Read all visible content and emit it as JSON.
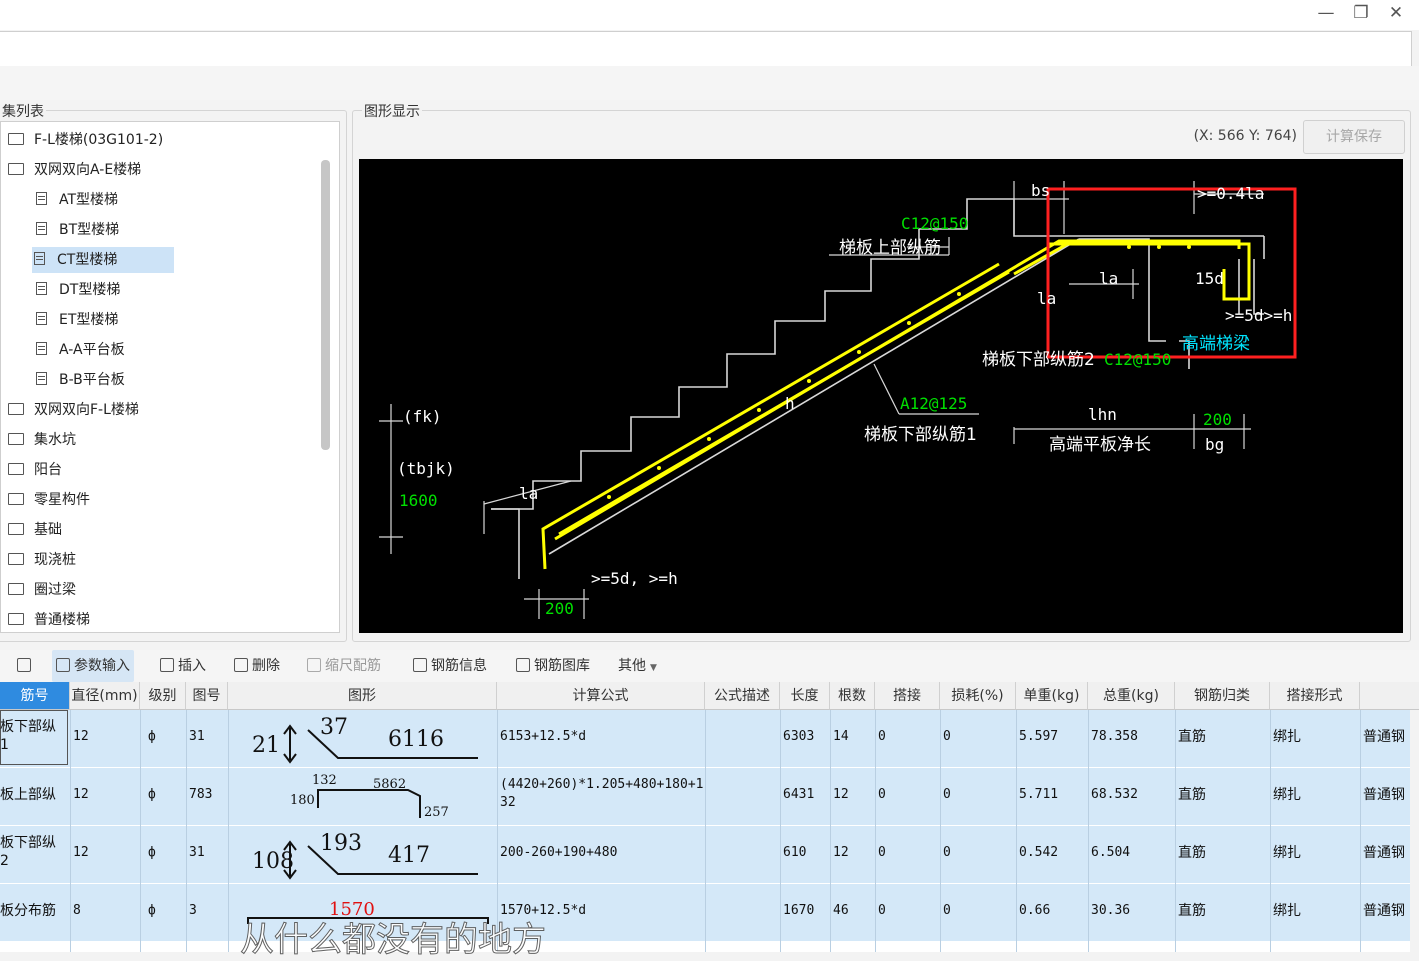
{
  "window": {
    "min": "—",
    "restore": "❐",
    "close": "✕"
  },
  "left_panel": {
    "title": "集列表",
    "items": [
      {
        "label": "F-L楼梯(03G101-2)",
        "type": "folder",
        "level": 0,
        "expanded": false
      },
      {
        "label": "双网双向A-E楼梯",
        "type": "folder",
        "level": 0,
        "expanded": true
      },
      {
        "label": "AT型楼梯",
        "type": "doc",
        "level": 1
      },
      {
        "label": "BT型楼梯",
        "type": "doc",
        "level": 1
      },
      {
        "label": "CT型楼梯",
        "type": "doc",
        "level": 1,
        "selected": true
      },
      {
        "label": "DT型楼梯",
        "type": "doc",
        "level": 1
      },
      {
        "label": "ET型楼梯",
        "type": "doc",
        "level": 1
      },
      {
        "label": "A-A平台板",
        "type": "doc",
        "level": 1
      },
      {
        "label": "B-B平台板",
        "type": "doc",
        "level": 1
      },
      {
        "label": "双网双向F-L楼梯",
        "type": "folder",
        "level": 0
      },
      {
        "label": "集水坑",
        "type": "folder",
        "level": 0
      },
      {
        "label": "阳台",
        "type": "folder",
        "level": 0
      },
      {
        "label": "零星构件",
        "type": "folder",
        "level": 0
      },
      {
        "label": "基础",
        "type": "folder",
        "level": 0
      },
      {
        "label": "现浇桩",
        "type": "folder",
        "level": 0
      },
      {
        "label": "圈过梁",
        "type": "folder",
        "level": 0
      },
      {
        "label": "普通楼梯",
        "type": "folder",
        "level": 0
      }
    ]
  },
  "graphic_panel": {
    "title": "图形显示",
    "coords": "(X: 566 Y: 764)",
    "save_button": "计算保存",
    "drawing": {
      "bs": "bs",
      "la_top": ">=0.4la",
      "c12_150": "C12@150",
      "upper_bar": "梯板上部纵筋",
      "la1": "la",
      "la2": "la",
      "d15": "15d",
      "d5h": ">=5d>=h",
      "high_beam": "高端梯梁",
      "lower_bar2": "梯板下部纵筋2",
      "lower_bar2_spec": "C12@150",
      "h": "h",
      "a12_125": "A12@125",
      "lower_bar1": "梯板下部纵筋1",
      "lhn": "lhn",
      "high_slab": "高端平板净长",
      "v200_right": "200",
      "bg": "bg",
      "fk": "(fk)",
      "tbjk": "(tbjk)",
      "v1600": "1600",
      "la_low": "la",
      "d5_low": ">=5d, >=h",
      "v200_low": "200"
    }
  },
  "toolbar": {
    "items": [
      {
        "label": "",
        "icon": "download-icon"
      },
      {
        "label": "参数输入",
        "icon": "param-icon",
        "active": true
      },
      {
        "label": "插入",
        "icon": "insert-icon"
      },
      {
        "label": "删除",
        "icon": "trash-icon"
      },
      {
        "label": "缩尺配筋",
        "icon": "scale-icon",
        "disabled": true
      },
      {
        "label": "钢筋信息",
        "icon": "info-icon"
      },
      {
        "label": "钢筋图库",
        "icon": "library-icon"
      },
      {
        "label": "其他",
        "icon": "chevron-down-icon"
      }
    ]
  },
  "table": {
    "columns": [
      "筋号",
      "直径(mm)",
      "级别",
      "图号",
      "图形",
      "计算公式",
      "公式描述",
      "长度",
      "根数",
      "搭接",
      "损耗(%)",
      "单重(kg)",
      "总重(kg)",
      "钢筋归类",
      "搭接形式",
      ""
    ],
    "rows": [
      {
        "name": "板下部纵\n1",
        "dia": "12",
        "grade": "ф",
        "fig": "31",
        "shape": {
          "a": "21",
          "b": "37",
          "c": "6116"
        },
        "formula": "6153+12.5*d",
        "desc": "",
        "len": "6303",
        "count": "14",
        "lap": "0",
        "loss": "0",
        "unit": "5.597",
        "total": "78.358",
        "cls": "直筋",
        "lapform": "绑扎",
        "extra": "普通钢"
      },
      {
        "name": "板上部纵",
        "dia": "12",
        "grade": "ф",
        "fig": "783",
        "shape": {
          "a": "180",
          "b": "132",
          "c": "5862",
          "d": "257"
        },
        "formula": "(4420+260)*1.205+480+180+1\n32",
        "desc": "",
        "len": "6431",
        "count": "12",
        "lap": "0",
        "loss": "0",
        "unit": "5.711",
        "total": "68.532",
        "cls": "直筋",
        "lapform": "绑扎",
        "extra": "普通钢"
      },
      {
        "name": "板下部纵\n2",
        "dia": "12",
        "grade": "ф",
        "fig": "31",
        "shape": {
          "a": "108",
          "b": "193",
          "c": "417"
        },
        "formula": "200-260+190+480",
        "desc": "",
        "len": "610",
        "count": "12",
        "lap": "0",
        "loss": "0",
        "unit": "0.542",
        "total": "6.504",
        "cls": "直筋",
        "lapform": "绑扎",
        "extra": "普通钢"
      },
      {
        "name": "板分布筋",
        "dia": "8",
        "grade": "ф",
        "fig": "3",
        "shape": {
          "a": "1570"
        },
        "formula": "1570+12.5*d",
        "desc": "",
        "len": "1670",
        "count": "46",
        "lap": "0",
        "loss": "0",
        "unit": "0.66",
        "total": "30.36",
        "cls": "直筋",
        "lapform": "绑扎",
        "extra": "普通钢"
      }
    ]
  },
  "subtitle": "从什么都没有的地方"
}
